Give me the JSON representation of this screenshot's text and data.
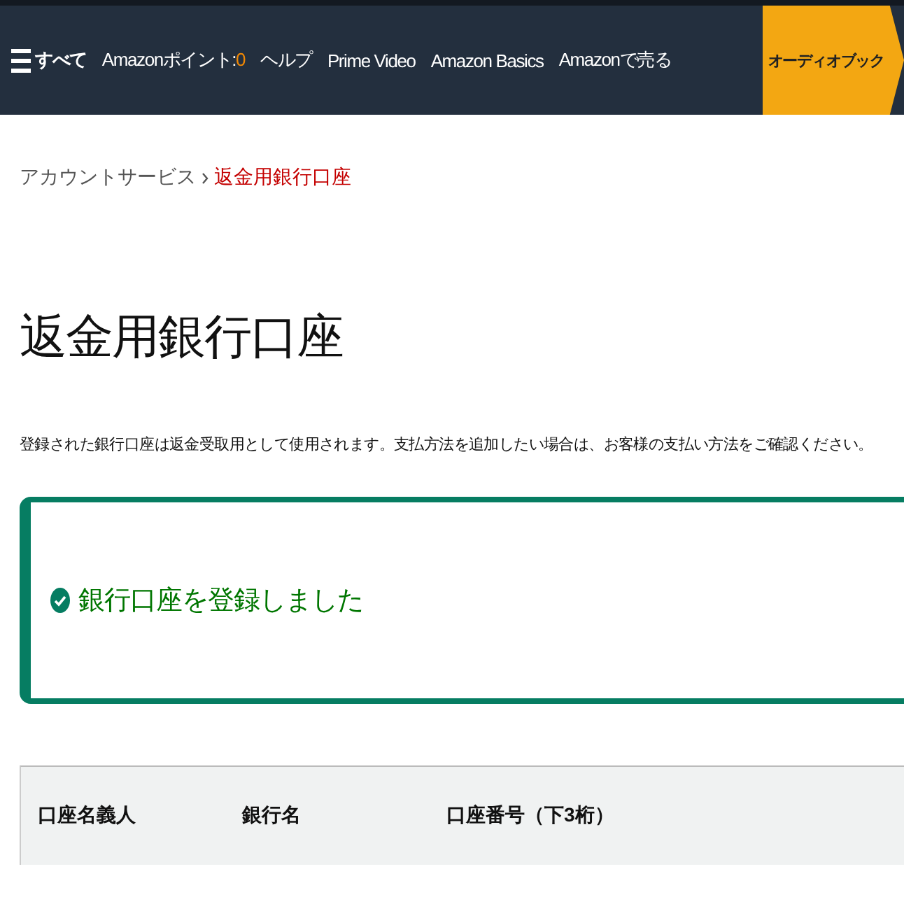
{
  "nav": {
    "menu_label": "すべて",
    "links": [
      {
        "kind": "points",
        "label": "Amazonポイント:",
        "value": "0"
      },
      {
        "kind": "link",
        "label": "ヘルプ"
      },
      {
        "kind": "link",
        "label": "Prime Video"
      },
      {
        "kind": "link",
        "label": "Amazon Basics"
      },
      {
        "kind": "link",
        "label": "Amazonで売る"
      }
    ],
    "promo": "オーディオブック"
  },
  "breadcrumb": [
    {
      "label": "アカウントサービス",
      "selected": false
    },
    {
      "label": "返金用銀行口座",
      "selected": true
    }
  ],
  "title": "返金用銀行口座",
  "description": "登録された銀行口座は返金受取用として使用されます。支払方法を追加したい場合は、お客様の支払い方法をご確認ください。",
  "alert": {
    "kind": "success",
    "message": "銀行口座を登録しました"
  },
  "table": {
    "columns": [
      "口座名義人",
      "銀行名",
      "口座番号（下3桁）"
    ]
  }
}
